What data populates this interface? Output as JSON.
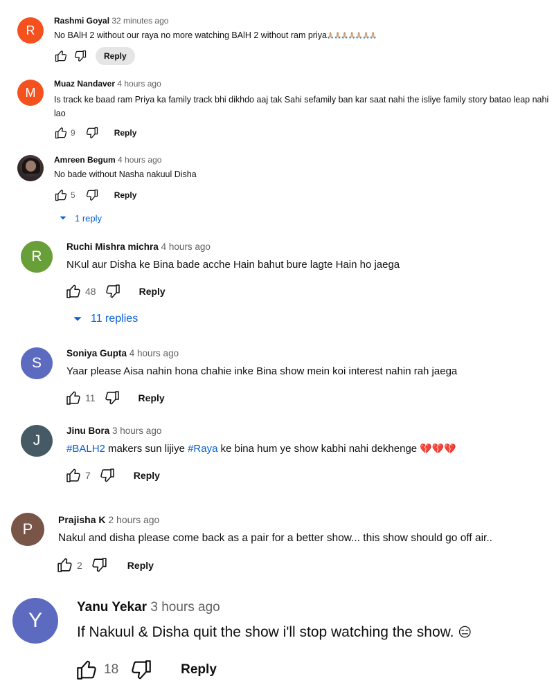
{
  "comments": [
    {
      "author": "Rashmi Goyal",
      "time": "32 minutes ago",
      "avatar_letter": "R",
      "avatar_color": "#f4511e",
      "text": "No BAlH 2 without our raya no more watching BAlH 2 without ram priya",
      "emoji": "🙏🏼🙏🏼🙏🏼🙏🏼🙏🏼🙏🏼🙏🏼",
      "likes": "",
      "reply_label": "Reply"
    },
    {
      "author": "Muaz Nandaver",
      "time": "4 hours ago",
      "avatar_letter": "M",
      "avatar_color": "#f4511e",
      "text": "Is track ke baad ram Priya ka family track bhi dikhdo aaj tak Sahi sefamily  ban kar saat nahi the isliye family story batao leap nahi lao",
      "likes": "9",
      "reply_label": "Reply"
    },
    {
      "author": "Amreen Begum",
      "time": "4 hours ago",
      "text": "No bade without Nasha nakuul Disha",
      "likes": "5",
      "reply_label": "Reply",
      "replies_label": "1 reply"
    },
    {
      "author": "Ruchi Mishra michra",
      "time": "4 hours ago",
      "avatar_letter": "R",
      "avatar_color": "#689f38",
      "text": "NKul aur Disha ke Bina bade acche Hain bahut bure lagte Hain ho jaega",
      "likes": "48",
      "reply_label": "Reply",
      "replies_label": "11 replies"
    },
    {
      "author": "Soniya Gupta",
      "time": "4 hours ago",
      "avatar_letter": "S",
      "avatar_color": "#5c6bc0",
      "text": "Yaar please Aisa nahin hona chahie inke Bina show mein koi interest nahin rah jaega",
      "likes": "11",
      "reply_label": "Reply"
    },
    {
      "author": "Jinu Bora",
      "time": "3 hours ago",
      "avatar_letter": "J",
      "avatar_color": "#455a64",
      "text_hashtag_1": "#BALH2",
      "text_mid": " makers sun lijiye ",
      "text_hashtag_2": "#Raya",
      "text_end": " ke bina hum ye show kabhi nahi dekhenge ",
      "emoji": "💔💔💔",
      "likes": "7",
      "reply_label": "Reply"
    },
    {
      "author": "Prajisha K",
      "time": "2 hours ago",
      "avatar_letter": "P",
      "avatar_color": "#795548",
      "text": "Nakul and disha please come back as a pair for a better show... this show should go off air..",
      "likes": "2",
      "reply_label": "Reply"
    },
    {
      "author": "Yanu Yekar",
      "time": "3 hours ago",
      "avatar_letter": "Y",
      "avatar_color": "#5c6bc0",
      "text": "If Nakuul & Disha quit the show i'll stop watching the show.",
      "emoji": "😑",
      "likes": "18",
      "reply_label": "Reply"
    }
  ]
}
